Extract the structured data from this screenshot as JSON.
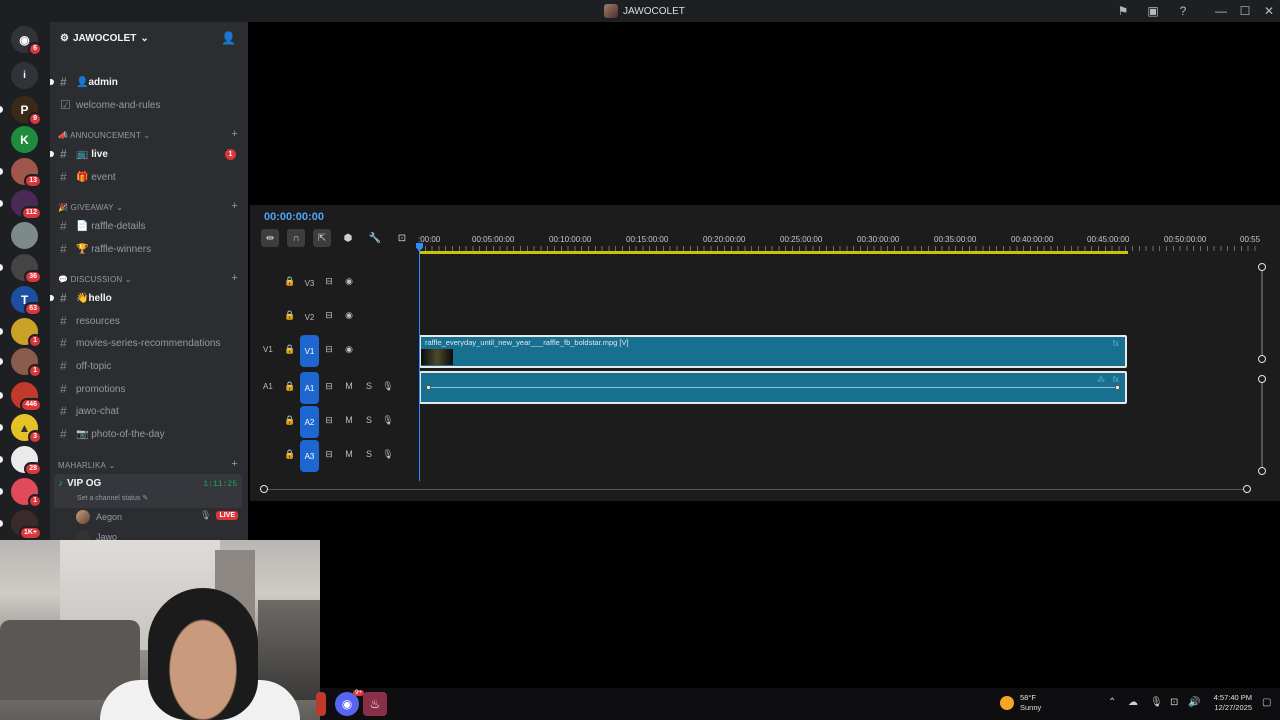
{
  "window": {
    "title": "JAWOCOLET"
  },
  "server": {
    "name": "JAWOCOLET"
  },
  "guild_badges": [
    "6",
    "9",
    "13",
    "112",
    "36",
    "63",
    "1",
    "1",
    "446",
    "3",
    "28",
    "1",
    "1K+"
  ],
  "channels": {
    "admin": "👤admin",
    "welcome": "welcome-and-rules",
    "cat_announcement": "📣 ANNOUNCEMENT",
    "live": "📺 live",
    "live_mention": "1",
    "event": "🎁 event",
    "cat_giveaway": "🎉 GIVEAWAY",
    "raffle_details": "📄 raffle-details",
    "raffle_winners": "🏆 raffle-winners",
    "cat_discussion": "💬 DISCUSSION",
    "hello": "👋hello",
    "resources": "resources",
    "movies": "movies-series-recommendations",
    "offtopic": "off-topic",
    "promotions": "promotions",
    "jawochat": "jawo-chat",
    "photo": "📷 photo-of-the-day",
    "cat_maharlika": "MAHARLIKA"
  },
  "voice": {
    "name": "VIP OG",
    "timer": "1:11:25",
    "status": "Set a channel status ✎",
    "user1": "Aegon",
    "user2": "Jawo",
    "live_label": "LIVE"
  },
  "editor": {
    "timecode": "00:00:00:00",
    "ruler_labels": [
      ":00:00",
      "00:05:00:00",
      "00:10:00:00",
      "00:15:00:00",
      "00:20:00:00",
      "00:25:00:00",
      "00:30:00:00",
      "00:35:00:00",
      "00:40:00:00",
      "00:45:00:00",
      "00:50:00:00",
      "00:55"
    ],
    "tracks": {
      "v3": "V3",
      "v2": "V2",
      "v1": "V1",
      "v1_src": "V1",
      "a1": "A1",
      "a1_src": "A1",
      "a2": "A2",
      "a3": "A3",
      "mute": "M",
      "solo": "S"
    },
    "video_clip": "raffle_everyday_until_new_year___raffle_fb_boldstar.mpg [V]",
    "fx_label": "fx"
  },
  "taskbar": {
    "temperature": "58°F",
    "condition": "Sunny",
    "time": "4:57:40 PM",
    "date": "12/27/2025",
    "steam_badge": "9+"
  },
  "colors": {
    "accent_blue": "#2f8cff",
    "clip_teal": "#177090",
    "discord_red": "#da373c",
    "online_green": "#23a559"
  }
}
